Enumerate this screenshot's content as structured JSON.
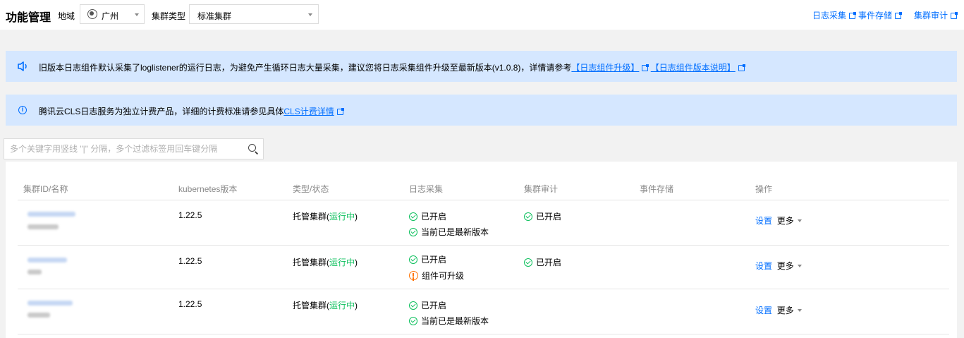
{
  "header": {
    "title": "功能管理",
    "region_label": "地域",
    "region_value": "广州",
    "cluster_type_label": "集群类型",
    "cluster_type_value": "标准集群",
    "links": [
      "日志采集",
      "事件存储",
      "集群审计"
    ]
  },
  "notices": {
    "upgrade": {
      "text": "旧版本日志组件默认采集了loglistener的运行日志，为避免产生循环日志大量采集，建议您将日志采集组件升级至最新版本(v1.0.8)，详情请参考",
      "link1": "【日志组件升级】",
      "link2": "【日志组件版本说明】"
    },
    "billing": {
      "text": "腾讯云CLS日志服务为独立计费产品，详细的计费标准请参见具体",
      "link": "CLS计费详情"
    }
  },
  "search": {
    "placeholder": "多个关键字用竖线 \"|\" 分隔，多个过滤标签用回车键分隔"
  },
  "table": {
    "columns": [
      "集群ID/名称",
      "kubernetes版本",
      "类型/状态",
      "日志采集",
      "集群审计",
      "事件存储",
      "操作"
    ],
    "rows": [
      {
        "k8s_version": "1.22.5",
        "type": "托管集群(",
        "status": "运行中",
        "type_close": ")",
        "log_status": "已开启",
        "log_version_status": "当前已是最新版本",
        "log_version_kind": "ok",
        "audit_status": "已开启",
        "action_settings": "设置",
        "action_more": "更多"
      },
      {
        "k8s_version": "1.22.5",
        "type": "托管集群(",
        "status": "运行中",
        "type_close": ")",
        "log_status": "已开启",
        "log_version_status": "组件可升级",
        "log_version_kind": "warn",
        "audit_status": "已开启",
        "action_settings": "设置",
        "action_more": "更多"
      },
      {
        "k8s_version": "1.22.5",
        "type": "托管集群(",
        "status": "运行中",
        "type_close": ")",
        "log_status": "已开启",
        "log_version_status": "当前已是最新版本",
        "log_version_kind": "ok",
        "audit_status": "",
        "action_settings": "设置",
        "action_more": "更多"
      }
    ]
  },
  "colors": {
    "accent": "#006eff",
    "success": "#0abf5b",
    "warning": "#ff7200",
    "notice_bg": "#d5e7ff"
  }
}
